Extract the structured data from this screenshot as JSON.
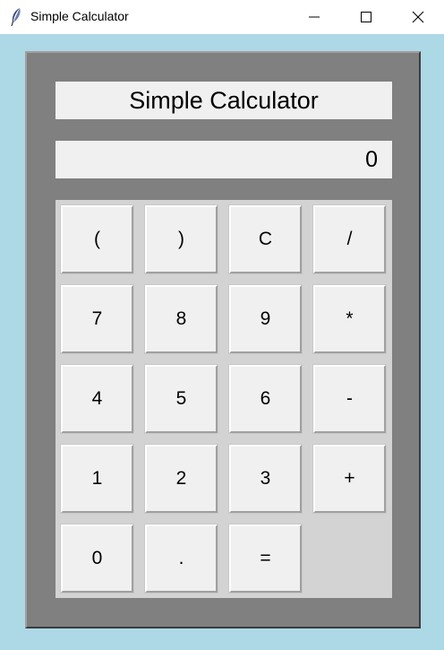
{
  "window": {
    "title": "Simple Calculator",
    "icon": "feather-icon",
    "controls": [
      "minimize-icon",
      "maximize-icon",
      "close-icon"
    ]
  },
  "calculator": {
    "heading": "Simple Calculator",
    "display_value": "0",
    "colors": {
      "background": "#add8e6",
      "frame": "#808080",
      "keypad": "#d3d3d3",
      "key": "#f0f0f0"
    },
    "keys": [
      "(",
      ")",
      "C",
      "/",
      "7",
      "8",
      "9",
      "*",
      "4",
      "5",
      "6",
      "-",
      "1",
      "2",
      "3",
      "+",
      "0",
      ".",
      "="
    ]
  }
}
